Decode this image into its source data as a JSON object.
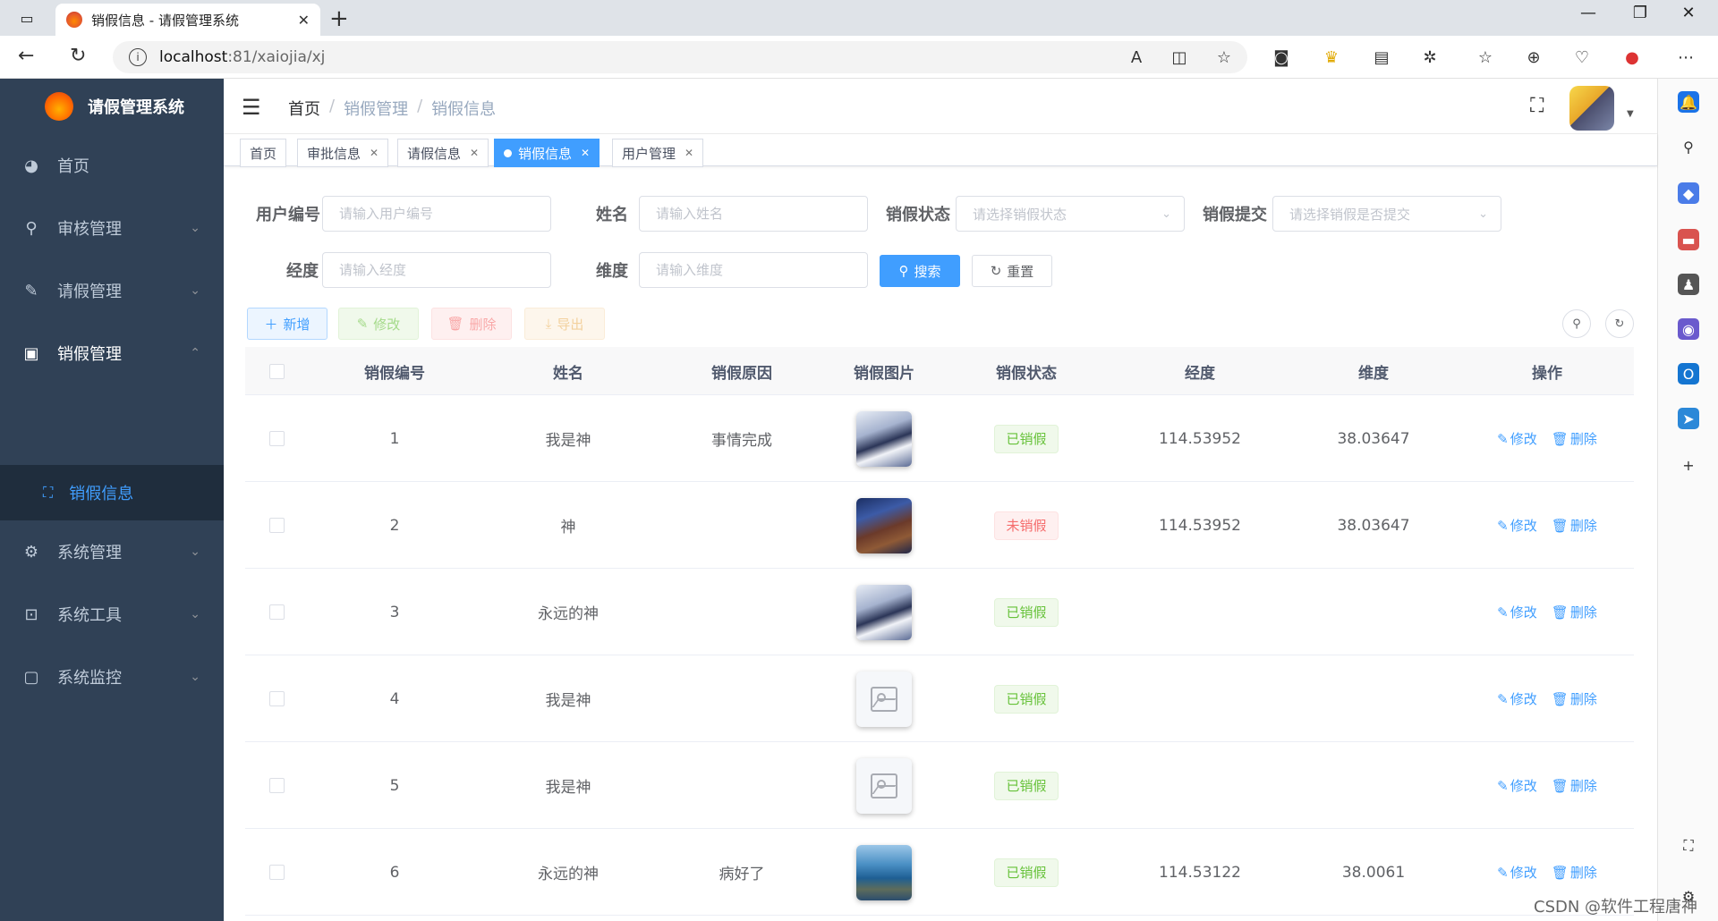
{
  "browser": {
    "tab_title": "销假信息 - 请假管理系统",
    "url_host": "localhost",
    "url_port_path": ":81/xaiojia/xj"
  },
  "app": {
    "title": "请假管理系统"
  },
  "sidebar": {
    "items": [
      {
        "label": "首页",
        "icon": "dashboard-icon"
      },
      {
        "label": "审核管理",
        "icon": "search-icon"
      },
      {
        "label": "请假管理",
        "icon": "edit-icon"
      },
      {
        "label": "销假管理",
        "icon": "monitor-icon"
      },
      {
        "label": "系统管理",
        "icon": "gear-icon"
      },
      {
        "label": "系统工具",
        "icon": "toolbox-icon"
      },
      {
        "label": "系统监控",
        "icon": "monitor-chart-icon"
      }
    ],
    "submenu": {
      "label": "销假信息",
      "icon": "expand-icon"
    }
  },
  "breadcrumb": [
    "首页",
    "销假管理",
    "销假信息"
  ],
  "tags": [
    {
      "label": "首页",
      "closable": false
    },
    {
      "label": "审批信息",
      "closable": true
    },
    {
      "label": "请假信息",
      "closable": true
    },
    {
      "label": "销假信息",
      "closable": true,
      "active": true
    },
    {
      "label": "用户管理",
      "closable": true
    }
  ],
  "filters": {
    "user_id_label": "用户编号",
    "user_id_placeholder": "请输入用户编号",
    "name_label": "姓名",
    "name_placeholder": "请输入姓名",
    "status_label": "销假状态",
    "status_placeholder": "请选择销假状态",
    "submit_label": "销假提交",
    "submit_placeholder": "请选择销假是否提交",
    "lng_label": "经度",
    "lng_placeholder": "请输入经度",
    "lat_label": "维度",
    "lat_placeholder": "请输入维度",
    "search_btn": "搜索",
    "reset_btn": "重置"
  },
  "toolbar": {
    "add": "新增",
    "edit": "修改",
    "delete": "删除",
    "export": "导出"
  },
  "table": {
    "columns": [
      "销假编号",
      "姓名",
      "销假原因",
      "销假图片",
      "销假状态",
      "经度",
      "维度",
      "操作"
    ],
    "rows": [
      {
        "id": "1",
        "name": "我是神",
        "reason": "事情完成",
        "image": "photo-a",
        "status": "已销假",
        "status_type": "ok",
        "lng": "114.53952",
        "lat": "38.03647"
      },
      {
        "id": "2",
        "name": "神",
        "reason": "",
        "image": "photo-b",
        "status": "未销假",
        "status_type": "no",
        "lng": "114.53952",
        "lat": "38.03647"
      },
      {
        "id": "3",
        "name": "永远的神",
        "reason": "",
        "image": "photo-a",
        "status": "已销假",
        "status_type": "ok",
        "lng": "",
        "lat": ""
      },
      {
        "id": "4",
        "name": "我是神",
        "reason": "",
        "image": "empty",
        "status": "已销假",
        "status_type": "ok",
        "lng": "",
        "lat": ""
      },
      {
        "id": "5",
        "name": "我是神",
        "reason": "",
        "image": "empty",
        "status": "已销假",
        "status_type": "ok",
        "lng": "",
        "lat": ""
      },
      {
        "id": "6",
        "name": "永远的神",
        "reason": "病好了",
        "image": "photo-c",
        "status": "已销假",
        "status_type": "ok",
        "lng": "114.53122",
        "lat": "38.0061"
      }
    ],
    "action_edit": "修改",
    "action_delete": "删除"
  },
  "watermark": "CSDN @软件工程唐神",
  "colors": {
    "sidebar_bg": "#304156",
    "primary": "#409eff",
    "success": "#67c23a",
    "danger": "#f56c6c"
  }
}
